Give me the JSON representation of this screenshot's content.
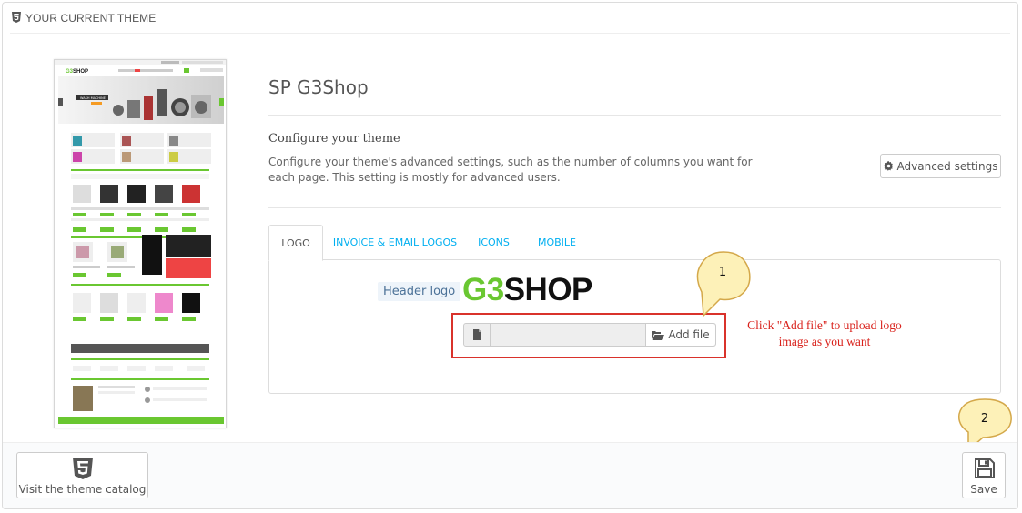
{
  "panel": {
    "heading": "YOUR CURRENT THEME",
    "heading_icon": "html5-icon"
  },
  "preview": {
    "alt": "theme preview",
    "thumbnail_text": [
      "G3SHOP",
      "WASH MACHINE"
    ]
  },
  "theme": {
    "name": "SP G3Shop",
    "configure_title": "Configure your theme",
    "configure_desc": "Configure your theme's advanced settings, such as the number of columns you want for each page. This setting is mostly for advanced users.",
    "advanced_btn": "Advanced settings",
    "advanced_icon": "gear-icon"
  },
  "tabs": [
    {
      "label": "LOGO",
      "active": true
    },
    {
      "label": "INVOICE & EMAIL LOGOS",
      "active": false
    },
    {
      "label": "ICONS",
      "active": false
    },
    {
      "label": "MOBILE",
      "active": false
    }
  ],
  "logo_tab": {
    "header_logo_label": "Header logo",
    "logo_part1": "G3",
    "logo_part2": "SHOP",
    "file_value": "",
    "add_file_btn": "Add file"
  },
  "annotations": {
    "bubble1": "1",
    "bubble2": "2",
    "callout": "Click \"Add file\" to upload logo image as you want"
  },
  "footer": {
    "catalog_btn": "Visit the theme catalog",
    "save_btn": "Save"
  },
  "colors": {
    "accent_link": "#00aff0",
    "logo_green": "#6ac731",
    "annotation_red": "#d9211b",
    "bubble_fill": "#fdf1b8",
    "bubble_stroke": "#d4a84a"
  }
}
